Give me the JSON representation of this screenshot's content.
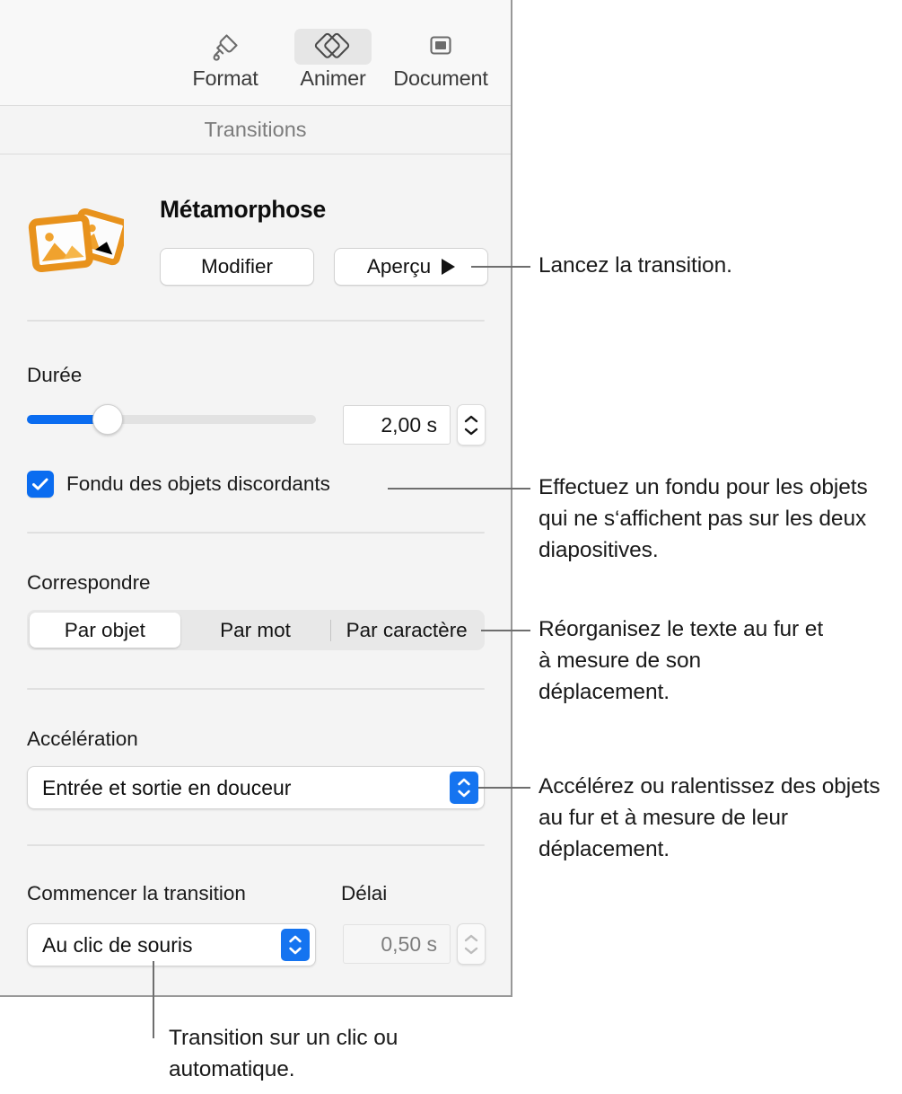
{
  "panel": {
    "tabs": [
      {
        "label": "Format",
        "icon": "paintbrush-icon",
        "selected": false
      },
      {
        "label": "Animer",
        "icon": "animate-diamonds-icon",
        "selected": true
      },
      {
        "label": "Document",
        "icon": "document-icon",
        "selected": false
      }
    ],
    "section_header": "Transitions",
    "transition": {
      "name": "Métamorphose",
      "icon": "transition-photos-icon",
      "edit_button": "Modifier",
      "preview_button": "Aperçu",
      "preview_icon": "play-icon"
    },
    "duration": {
      "label": "Durée",
      "value": "2,00 s",
      "slider_percent": 28,
      "stepper_icon": "stepper-up-down-icon"
    },
    "fade": {
      "label": "Fondu des objets discordants",
      "checked": true,
      "check_icon": "checkmark-icon"
    },
    "match": {
      "label": "Correspondre",
      "options": [
        "Par objet",
        "Par mot",
        "Par caractère"
      ],
      "selected": "Par objet"
    },
    "acceleration": {
      "label": "Accélération",
      "value": "Entrée et sortie en douceur",
      "popup_icon": "popup-chevrons-icon"
    },
    "start": {
      "label": "Commencer la transition",
      "value": "Au clic de souris",
      "popup_icon": "popup-chevrons-icon"
    },
    "delay": {
      "label": "Délai",
      "value": "0,50 s",
      "disabled": true,
      "stepper_icon": "stepper-up-down-icon"
    }
  },
  "annotations": [
    {
      "id": "preview",
      "text": "Lancez la transition."
    },
    {
      "id": "fade",
      "text": "Effectuez un fondu pour les objets qui ne s‘affichent pas sur les deux diapositives."
    },
    {
      "id": "match",
      "text": "Réorganisez le texte au fur et à mesure de son déplacement."
    },
    {
      "id": "acceleration",
      "text": "Accélérez ou ralentissez des objets au fur et à mesure de leur déplacement."
    },
    {
      "id": "start",
      "text": "Transition sur un clic ou automatique."
    }
  ],
  "colors": {
    "accent_blue": "#0a6cf0",
    "panel_bg": "#f4f4f4",
    "icon_orange": "#f0a22e",
    "callout_gray": "#6e6e6e"
  }
}
